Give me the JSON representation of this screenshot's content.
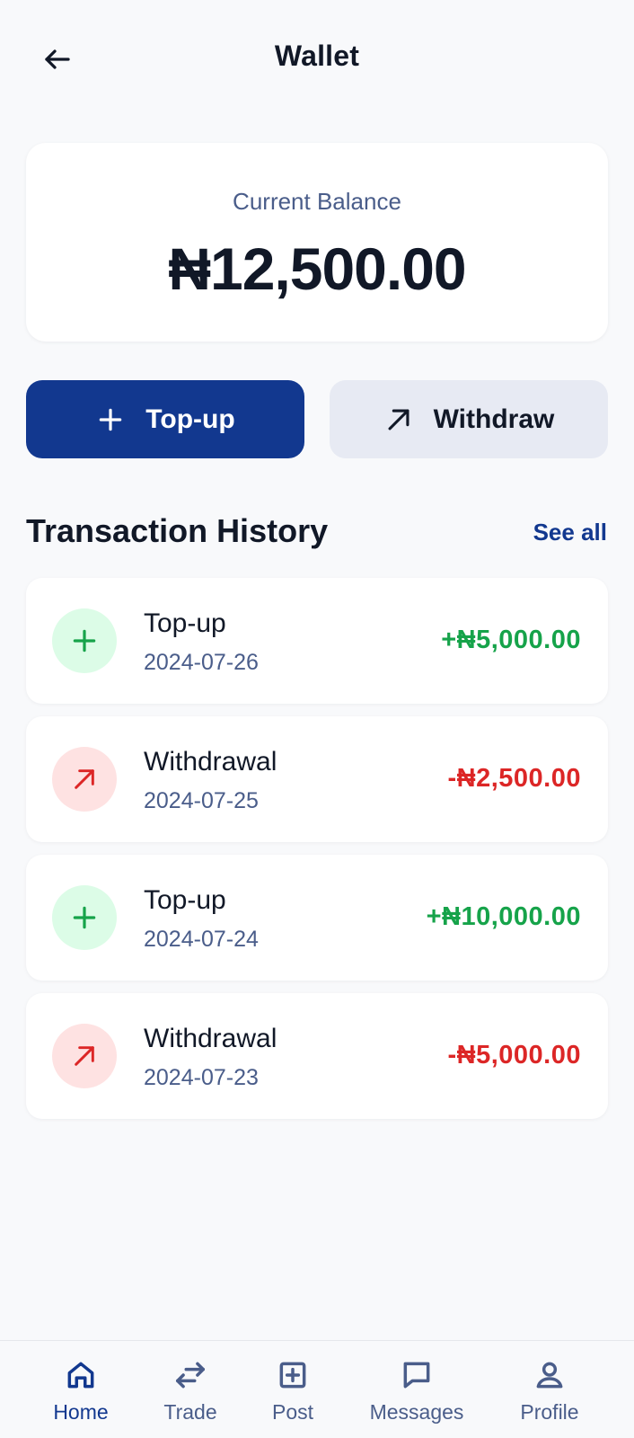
{
  "header": {
    "title": "Wallet"
  },
  "balance": {
    "label": "Current Balance",
    "amount": "₦12,500.00"
  },
  "actions": {
    "topup_label": "Top-up",
    "withdraw_label": "Withdraw"
  },
  "history": {
    "title": "Transaction History",
    "see_all": "See all",
    "items": [
      {
        "type": "Top-up",
        "date": "2024-07-26",
        "amount": "+₦5,000.00",
        "direction": "credit"
      },
      {
        "type": "Withdrawal",
        "date": "2024-07-25",
        "amount": "-₦2,500.00",
        "direction": "debit"
      },
      {
        "type": "Top-up",
        "date": "2024-07-24",
        "amount": "+₦10,000.00",
        "direction": "credit"
      },
      {
        "type": "Withdrawal",
        "date": "2024-07-23",
        "amount": "-₦5,000.00",
        "direction": "debit"
      }
    ]
  },
  "nav": {
    "items": [
      {
        "label": "Home",
        "icon": "home-icon",
        "active": true
      },
      {
        "label": "Trade",
        "icon": "swap-icon",
        "active": false
      },
      {
        "label": "Post",
        "icon": "plus-square-icon",
        "active": false
      },
      {
        "label": "Messages",
        "icon": "chat-icon",
        "active": false
      },
      {
        "label": "Profile",
        "icon": "user-icon",
        "active": false
      }
    ]
  },
  "colors": {
    "primary": "#12388f",
    "credit": "#16a34a",
    "debit": "#dc2626",
    "muted": "#4a5d8a",
    "background": "#f8f9fb"
  }
}
